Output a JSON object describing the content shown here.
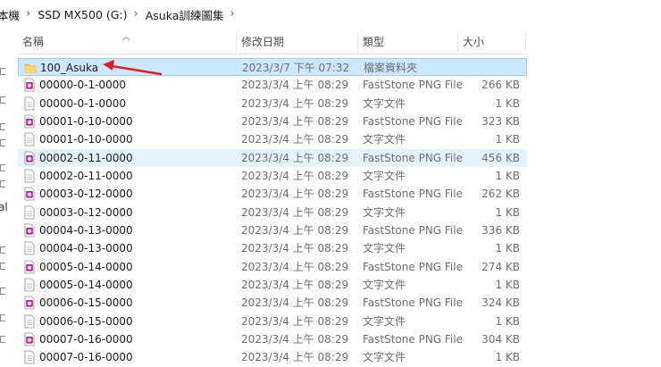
{
  "breadcrumb": [
    {
      "label": "本機"
    },
    {
      "label": "SSD MX500 (G:)"
    },
    {
      "label": "Asuka訓練圖集"
    }
  ],
  "nav_pane": {
    "letter": "al"
  },
  "columns": {
    "name": "名稱",
    "modified": "修改日期",
    "type": "類型",
    "size": "大小"
  },
  "files": [
    {
      "name": "100_Asuka",
      "modified": "2023/3/7 下午 07:32",
      "type": "檔案資料夾",
      "size": "",
      "icon": "folder-icon"
    },
    {
      "name": "00000-0-1-0000",
      "modified": "2023/3/4 上午 08:29",
      "type": "FastStone PNG File",
      "size": "266 KB",
      "icon": "png-file-icon"
    },
    {
      "name": "00000-0-1-0000",
      "modified": "2023/3/4 上午 08:29",
      "type": "文字文件",
      "size": "1 KB",
      "icon": "text-file-icon"
    },
    {
      "name": "00001-0-10-0000",
      "modified": "2023/3/4 上午 08:29",
      "type": "FastStone PNG File",
      "size": "323 KB",
      "icon": "png-file-icon"
    },
    {
      "name": "00001-0-10-0000",
      "modified": "2023/3/4 上午 08:29",
      "type": "文字文件",
      "size": "1 KB",
      "icon": "text-file-icon"
    },
    {
      "name": "00002-0-11-0000",
      "modified": "2023/3/4 上午 08:29",
      "type": "FastStone PNG File",
      "size": "456 KB",
      "icon": "png-file-icon"
    },
    {
      "name": "00002-0-11-0000",
      "modified": "2023/3/4 上午 08:29",
      "type": "文字文件",
      "size": "1 KB",
      "icon": "text-file-icon"
    },
    {
      "name": "00003-0-12-0000",
      "modified": "2023/3/4 上午 08:29",
      "type": "FastStone PNG File",
      "size": "262 KB",
      "icon": "png-file-icon"
    },
    {
      "name": "00003-0-12-0000",
      "modified": "2023/3/4 上午 08:29",
      "type": "文字文件",
      "size": "1 KB",
      "icon": "text-file-icon"
    },
    {
      "name": "00004-0-13-0000",
      "modified": "2023/3/4 上午 08:29",
      "type": "FastStone PNG File",
      "size": "336 KB",
      "icon": "png-file-icon"
    },
    {
      "name": "00004-0-13-0000",
      "modified": "2023/3/4 上午 08:29",
      "type": "文字文件",
      "size": "1 KB",
      "icon": "text-file-icon"
    },
    {
      "name": "00005-0-14-0000",
      "modified": "2023/3/4 上午 08:29",
      "type": "FastStone PNG File",
      "size": "274 KB",
      "icon": "png-file-icon"
    },
    {
      "name": "00005-0-14-0000",
      "modified": "2023/3/4 上午 08:29",
      "type": "文字文件",
      "size": "1 KB",
      "icon": "text-file-icon"
    },
    {
      "name": "00006-0-15-0000",
      "modified": "2023/3/4 上午 08:29",
      "type": "FastStone PNG File",
      "size": "324 KB",
      "icon": "png-file-icon"
    },
    {
      "name": "00006-0-15-0000",
      "modified": "2023/3/4 上午 08:29",
      "type": "文字文件",
      "size": "1 KB",
      "icon": "text-file-icon"
    },
    {
      "name": "00007-0-16-0000",
      "modified": "2023/3/4 上午 08:29",
      "type": "FastStone PNG File",
      "size": "304 KB",
      "icon": "png-file-icon"
    },
    {
      "name": "00007-0-16-0000",
      "modified": "2023/3/4 上午 08:29",
      "type": "文字文件",
      "size": "1 KB",
      "icon": "text-file-icon"
    }
  ],
  "state": {
    "selected_index": 0,
    "hovered_index": 5
  },
  "colors": {
    "selection": "#cce8ff",
    "hover": "#e5f3ff",
    "folder": "#f3c449",
    "png_badge": "#b0288c",
    "arrow": "#e02020"
  }
}
